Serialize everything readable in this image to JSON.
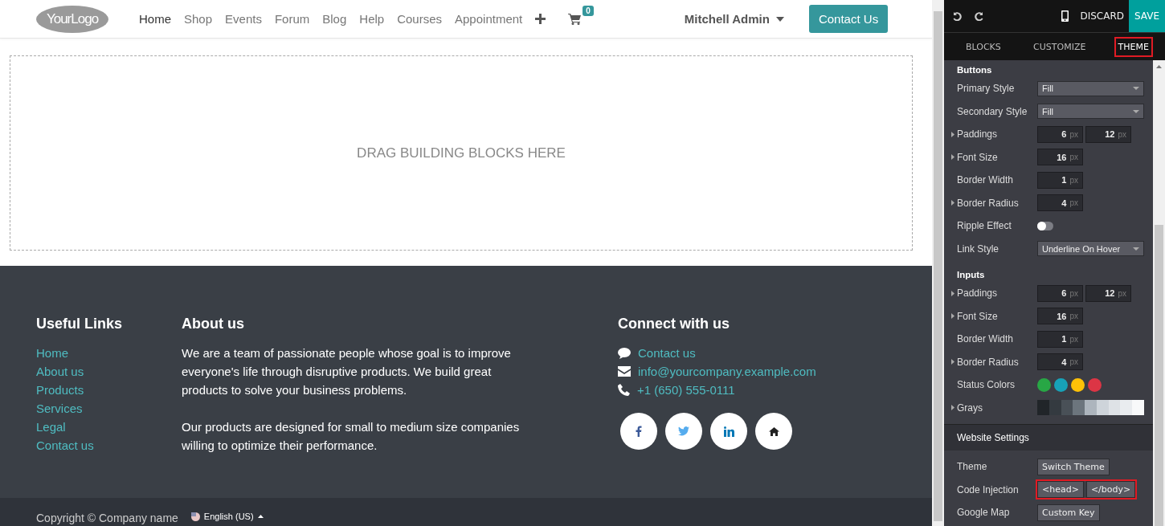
{
  "header": {
    "logo": "**Your**Logo",
    "nav": [
      {
        "label": "Home",
        "selected": true
      },
      {
        "label": "Shop",
        "selected": false
      },
      {
        "label": "Events",
        "selected": false
      },
      {
        "label": "Forum",
        "selected": false
      },
      {
        "label": "Blog",
        "selected": false
      },
      {
        "label": "Help",
        "selected": false
      },
      {
        "label": "Courses",
        "selected": false
      },
      {
        "label": "Appointment",
        "selected": false
      }
    ],
    "cart_count": "0",
    "user": "Mitchell Admin",
    "cta": "Contact Us"
  },
  "drop_zone": "DRAG BUILDING BLOCKS HERE",
  "footer": {
    "links_title": "Useful Links",
    "links": [
      "Home",
      "About us",
      "Products",
      "Services",
      "Legal",
      "Contact us"
    ],
    "about_title": "About us",
    "about": [
      "We are a team of passionate people whose goal is to improve everyone's life through disruptive products. We build great products to solve your business problems.",
      "Our products are designed for small to medium size companies willing to optimize their performance."
    ],
    "connect_title": "Connect with us",
    "contacts": [
      {
        "kind": "chat",
        "text": "Contact us"
      },
      {
        "kind": "mail",
        "text": "info@yourcompany.example.com"
      },
      {
        "kind": "phone",
        "text": "+1 (650) 555-0111"
      }
    ],
    "social": [
      {
        "kind": "facebook"
      },
      {
        "kind": "twitter"
      },
      {
        "kind": "linkedin"
      },
      {
        "kind": "home"
      }
    ],
    "copyright": "Copyright © Company name",
    "language": "English (US)"
  },
  "editor": {
    "discard": "DISCARD",
    "save": "SAVE",
    "tabs": [
      {
        "label": "BLOCKS",
        "selected": false,
        "highlighted": false
      },
      {
        "label": "CUSTOMIZE",
        "selected": false,
        "highlighted": false
      },
      {
        "label": "THEME",
        "selected": true,
        "highlighted": true
      }
    ],
    "sections": [
      {
        "title": "Buttons",
        "kind": "plain",
        "rows": [
          {
            "kind": "select",
            "label": "Primary Style",
            "expandable": false,
            "value": "Fill"
          },
          {
            "kind": "select",
            "label": "Secondary Style",
            "expandable": false,
            "value": "Fill"
          },
          {
            "kind": "number",
            "label": "Paddings",
            "expandable": true,
            "values": [
              {
                "value": "6",
                "unit": "px"
              },
              {
                "value": "12",
                "unit": "px"
              }
            ]
          },
          {
            "kind": "number",
            "label": "Font Size",
            "expandable": true,
            "values": [
              {
                "value": "16",
                "unit": "px"
              }
            ]
          },
          {
            "kind": "number",
            "label": "Border Width",
            "expandable": false,
            "values": [
              {
                "value": "1",
                "unit": "px"
              }
            ]
          },
          {
            "kind": "number",
            "label": "Border Radius",
            "expandable": true,
            "values": [
              {
                "value": "4",
                "unit": "px"
              }
            ]
          },
          {
            "kind": "toggle",
            "label": "Ripple Effect",
            "expandable": false,
            "on": false
          },
          {
            "kind": "select",
            "label": "Link Style",
            "expandable": false,
            "value": "Underline On Hover"
          }
        ]
      },
      {
        "title": "Inputs",
        "kind": "plain",
        "rows": [
          {
            "kind": "number",
            "label": "Paddings",
            "expandable": true,
            "values": [
              {
                "value": "6",
                "unit": "px"
              },
              {
                "value": "12",
                "unit": "px"
              }
            ]
          },
          {
            "kind": "number",
            "label": "Font Size",
            "expandable": true,
            "values": [
              {
                "value": "16",
                "unit": "px"
              }
            ]
          },
          {
            "kind": "number",
            "label": "Border Width",
            "expandable": false,
            "values": [
              {
                "value": "1",
                "unit": "px"
              }
            ]
          },
          {
            "kind": "number",
            "label": "Border Radius",
            "expandable": true,
            "values": [
              {
                "value": "4",
                "unit": "px"
              }
            ]
          },
          {
            "kind": "colors",
            "label": "Status Colors",
            "expandable": false,
            "colors": [
              {
                "color": "#28a745"
              },
              {
                "color": "#17a2b8"
              },
              {
                "color": "#ffc107"
              },
              {
                "color": "#dc3545"
              }
            ]
          },
          {
            "kind": "grays",
            "label": "Grays",
            "expandable": true,
            "colors": [
              {
                "color": "#212529"
              },
              {
                "color": "#343a40"
              },
              {
                "color": "#495057"
              },
              {
                "color": "#6c757d"
              },
              {
                "color": "#adb5bd"
              },
              {
                "color": "#ced4da"
              },
              {
                "color": "#dee2e6"
              },
              {
                "color": "#e9ecef"
              },
              {
                "color": "#f8f9fa"
              }
            ]
          }
        ]
      },
      {
        "title": "Website Settings",
        "kind": "band",
        "rows": [
          {
            "kind": "buttons",
            "label": "Theme",
            "expandable": false,
            "highlighted": false,
            "buttons": [
              "Switch Theme"
            ]
          },
          {
            "kind": "buttons",
            "label": "Code Injection",
            "expandable": false,
            "highlighted": true,
            "buttons": [
              "<head>",
              "</body>"
            ]
          },
          {
            "kind": "buttons",
            "label": "Google Map",
            "expandable": false,
            "highlighted": false,
            "buttons": [
              "Custom Key"
            ]
          }
        ]
      }
    ]
  }
}
